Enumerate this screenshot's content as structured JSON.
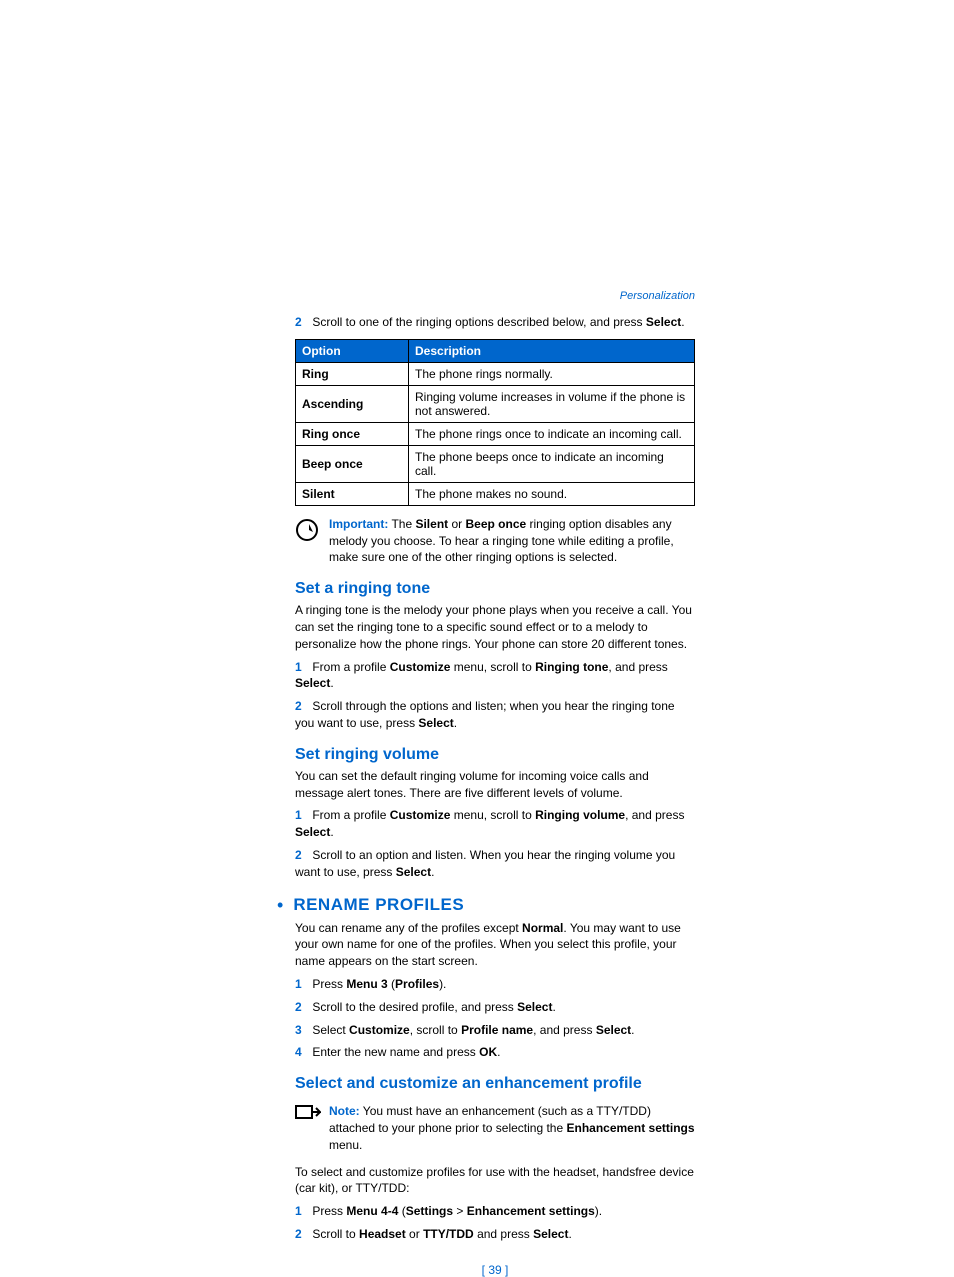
{
  "header": {
    "breadcrumb": "Personalization"
  },
  "intro_step": {
    "num": "2",
    "pre": "Scroll to one of the ringing options described below, and press ",
    "bold": "Select",
    "post": "."
  },
  "table": {
    "headers": {
      "option": "Option",
      "description": "Description"
    },
    "rows": [
      {
        "option": "Ring",
        "desc": "The phone rings normally."
      },
      {
        "option": "Ascending",
        "desc": "Ringing volume increases in volume if the phone is not answered."
      },
      {
        "option": "Ring once",
        "desc": "The phone rings once to indicate an incoming call."
      },
      {
        "option": "Beep once",
        "desc": "The phone beeps once to indicate an incoming call."
      },
      {
        "option": "Silent",
        "desc": "The phone makes no sound."
      }
    ]
  },
  "important": {
    "label": "Important:",
    "t1": " The ",
    "b1": "Silent",
    "t2": " or ",
    "b2": "Beep once",
    "t3": " ringing option disables any melody you choose. To hear a ringing tone while editing a profile, make sure one of the other ringing options is selected."
  },
  "ringing_tone": {
    "heading": "Set a ringing tone",
    "para": "A ringing tone is the melody your phone plays when you receive a call. You can set the ringing tone to a specific sound effect or to a melody to personalize how the phone rings. Your phone can store 20 different tones.",
    "s1": {
      "num": "1",
      "t1": "From a profile ",
      "b1": "Customize",
      "t2": " menu, scroll to ",
      "b2": "Ringing tone",
      "t3": ", and press ",
      "b3": "Select",
      "t4": "."
    },
    "s2": {
      "num": "2",
      "t1": "Scroll through the options and listen; when you hear the ringing tone you want to use, press ",
      "b1": "Select",
      "t2": "."
    }
  },
  "ringing_volume": {
    "heading": "Set ringing volume",
    "para": "You can set the default ringing volume for incoming voice calls and message alert tones. There are five different levels of volume.",
    "s1": {
      "num": "1",
      "t1": "From a profile ",
      "b1": "Customize",
      "t2": " menu, scroll to ",
      "b2": "Ringing volume",
      "t3": ", and press ",
      "b3": "Select",
      "t4": "."
    },
    "s2": {
      "num": "2",
      "t1": "Scroll to an option and listen. When you hear the ringing volume you want to use, press ",
      "b1": "Select",
      "t2": "."
    }
  },
  "rename": {
    "heading": "RENAME PROFILES",
    "para": {
      "t1": "You can rename any of the profiles except ",
      "b1": "Normal",
      "t2": ". You may want to use your own name for one of the profiles. When you select this profile, your name appears on the start screen."
    },
    "s1": {
      "num": "1",
      "t1": "Press ",
      "b1": "Menu 3",
      "t2": " (",
      "b2": "Profiles",
      "t3": ")."
    },
    "s2": {
      "num": "2",
      "t1": "Scroll to the desired profile, and press ",
      "b1": "Select",
      "t2": "."
    },
    "s3": {
      "num": "3",
      "t1": "Select ",
      "b1": "Customize",
      "t2": ", scroll to ",
      "b2": "Profile name",
      "t3": ", and press ",
      "b3": "Select",
      "t4": "."
    },
    "s4": {
      "num": "4",
      "t1": "Enter the new name and press ",
      "b1": "OK",
      "t2": "."
    }
  },
  "enhancement": {
    "heading": "Select and customize an enhancement profile",
    "note": {
      "label": "Note:",
      "t1": " You must have an enhancement (such as a TTY/TDD) attached to your phone prior to selecting the ",
      "b1": "Enhancement settings",
      "t2": " menu."
    },
    "para": "To select and customize profiles for use with the headset, handsfree device (car kit), or TTY/TDD:",
    "s1": {
      "num": "1",
      "t1": "Press ",
      "b1": "Menu 4-4",
      "t2": " (",
      "b2": "Settings",
      "t3": " > ",
      "b3": "Enhancement settings",
      "t4": ")."
    },
    "s2": {
      "num": "2",
      "t1": "Scroll to ",
      "b1": "Headset",
      "t2": " or ",
      "b2": "TTY/TDD",
      "t3": " and press ",
      "b3": "Select",
      "t4": "."
    }
  },
  "pagenum": "[ 39 ]"
}
